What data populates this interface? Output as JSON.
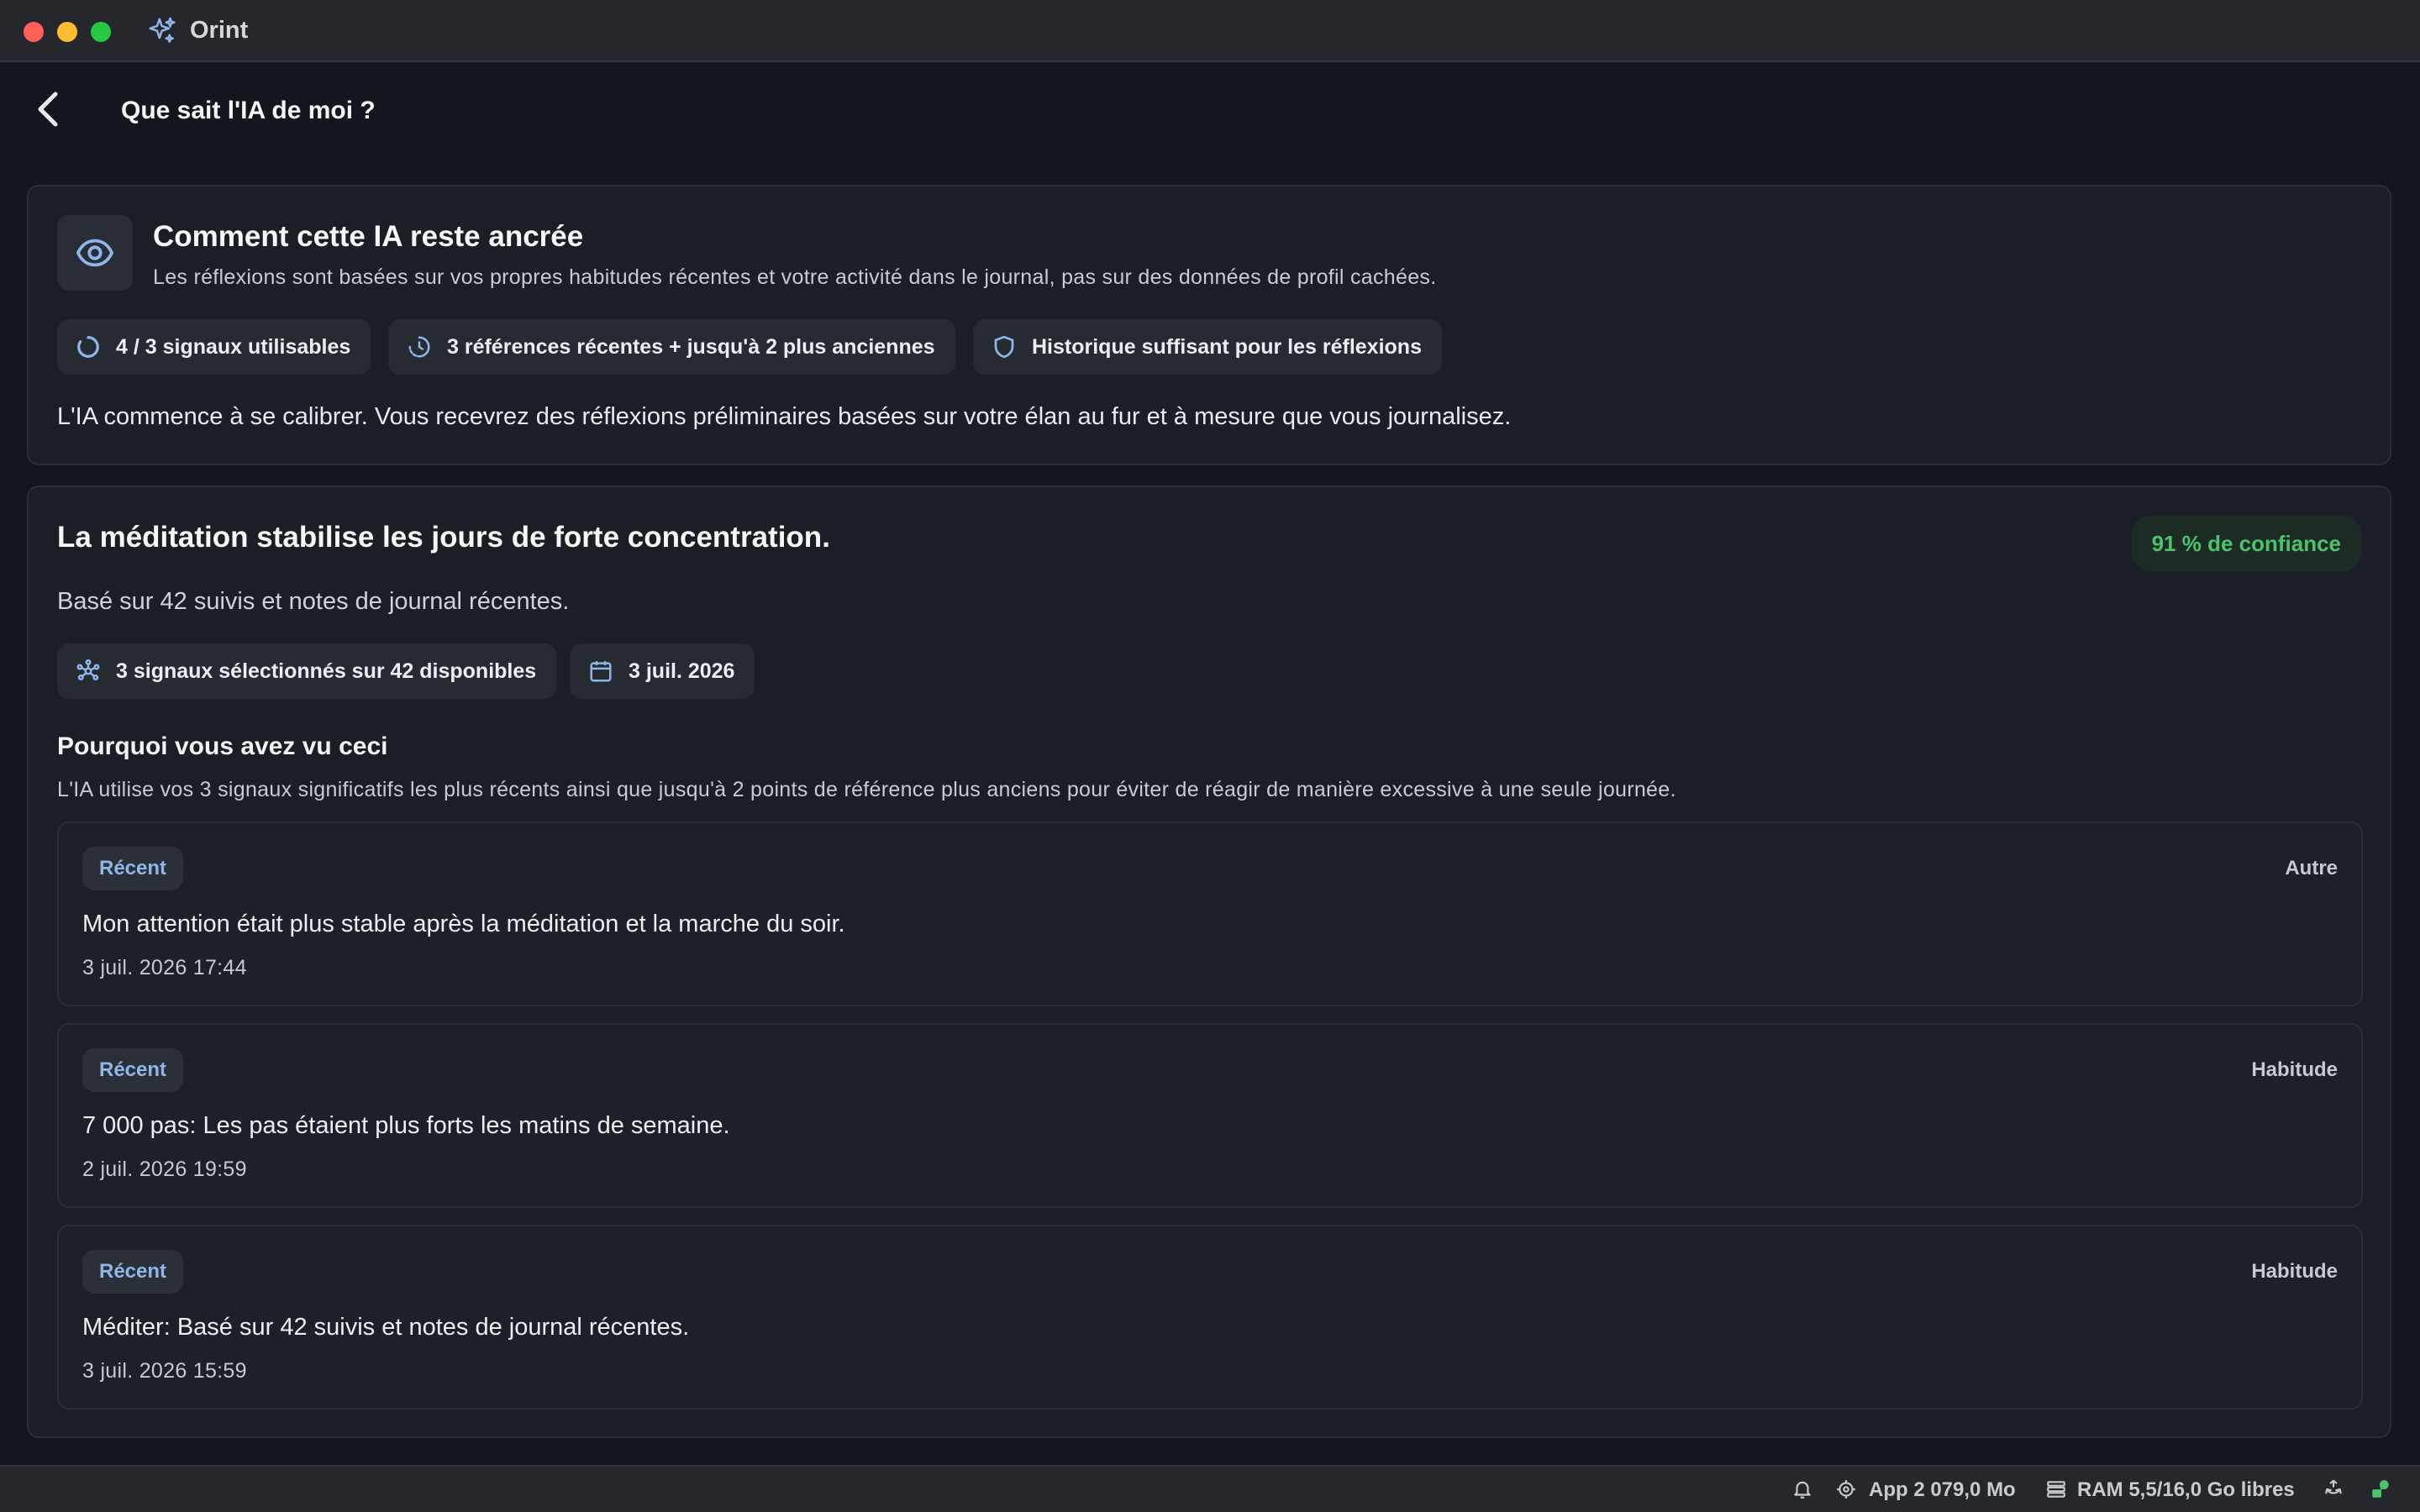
{
  "window": {
    "app_name": "Orint"
  },
  "header": {
    "title": "Que sait l'IA de moi ?"
  },
  "grounding_card": {
    "title": "Comment cette IA reste ancrée",
    "description": "Les réflexions sont basées sur vos propres habitudes récentes et votre activité dans le journal, pas sur des données de profil cachées.",
    "chips": [
      {
        "icon": "progress-ring-icon",
        "label": "4 / 3 signaux utilisables"
      },
      {
        "icon": "clock-history-icon",
        "label": "3 références récentes + jusqu'à 2 plus anciennes"
      },
      {
        "icon": "shield-icon",
        "label": "Historique suffisant pour les réflexions"
      }
    ],
    "note": "L'IA commence à se calibrer. Vous recevrez des réflexions préliminaires basées sur votre élan au fur et à mesure que vous journalisez."
  },
  "insight_card": {
    "title": "La méditation stabilise les jours de forte concentration.",
    "confidence": "91 % de confiance",
    "confidence_color": "#4cc26a",
    "basis": "Basé sur 42 suivis et notes de journal récentes.",
    "chips": [
      {
        "icon": "network-icon",
        "label": "3 signaux sélectionnés sur 42 disponibles"
      },
      {
        "icon": "calendar-icon",
        "label": "3 juil. 2026"
      }
    ],
    "why_title": "Pourquoi vous avez vu ceci",
    "why_desc": "L'IA utilise vos 3 signaux significatifs les plus récents ainsi que jusqu'à 2 points de référence plus anciens pour éviter de réagir de manière excessive à une seule journée.",
    "entries": [
      {
        "tag": "Récent",
        "category": "Autre",
        "text": "Mon attention était plus stable après la méditation et la marche du soir.",
        "date": "3 juil. 2026 17:44"
      },
      {
        "tag": "Récent",
        "category": "Habitude",
        "text": "7 000 pas: Les pas étaient plus forts les matins de semaine.",
        "date": "2 juil. 2026 19:59"
      },
      {
        "tag": "Récent",
        "category": "Habitude",
        "text": "Méditer: Basé sur 42 suivis et notes de journal récentes.",
        "date": "3 juil. 2026 15:59"
      }
    ]
  },
  "statusbar": {
    "app_memory": "App 2 079,0 Mo",
    "ram": "RAM 5,5/16,0 Go libres"
  }
}
